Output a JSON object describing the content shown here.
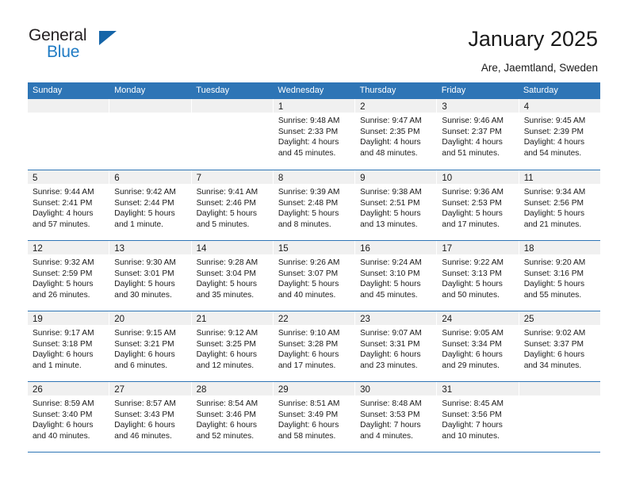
{
  "brand": {
    "name_part1": "General",
    "name_part2": "Blue"
  },
  "header": {
    "title": "January 2025",
    "location": "Are, Jaemtland, Sweden"
  },
  "calendar": {
    "weekday_headers": [
      "Sunday",
      "Monday",
      "Tuesday",
      "Wednesday",
      "Thursday",
      "Friday",
      "Saturday"
    ],
    "accent_color": "#2e75b6",
    "daynum_band_color": "#f0f0f0",
    "weeks": [
      [
        {
          "day": "",
          "sunrise": "",
          "sunset": "",
          "daylight_line1": "",
          "daylight_line2": ""
        },
        {
          "day": "",
          "sunrise": "",
          "sunset": "",
          "daylight_line1": "",
          "daylight_line2": ""
        },
        {
          "day": "",
          "sunrise": "",
          "sunset": "",
          "daylight_line1": "",
          "daylight_line2": ""
        },
        {
          "day": "1",
          "sunrise": "Sunrise: 9:48 AM",
          "sunset": "Sunset: 2:33 PM",
          "daylight_line1": "Daylight: 4 hours",
          "daylight_line2": "and 45 minutes."
        },
        {
          "day": "2",
          "sunrise": "Sunrise: 9:47 AM",
          "sunset": "Sunset: 2:35 PM",
          "daylight_line1": "Daylight: 4 hours",
          "daylight_line2": "and 48 minutes."
        },
        {
          "day": "3",
          "sunrise": "Sunrise: 9:46 AM",
          "sunset": "Sunset: 2:37 PM",
          "daylight_line1": "Daylight: 4 hours",
          "daylight_line2": "and 51 minutes."
        },
        {
          "day": "4",
          "sunrise": "Sunrise: 9:45 AM",
          "sunset": "Sunset: 2:39 PM",
          "daylight_line1": "Daylight: 4 hours",
          "daylight_line2": "and 54 minutes."
        }
      ],
      [
        {
          "day": "5",
          "sunrise": "Sunrise: 9:44 AM",
          "sunset": "Sunset: 2:41 PM",
          "daylight_line1": "Daylight: 4 hours",
          "daylight_line2": "and 57 minutes."
        },
        {
          "day": "6",
          "sunrise": "Sunrise: 9:42 AM",
          "sunset": "Sunset: 2:44 PM",
          "daylight_line1": "Daylight: 5 hours",
          "daylight_line2": "and 1 minute."
        },
        {
          "day": "7",
          "sunrise": "Sunrise: 9:41 AM",
          "sunset": "Sunset: 2:46 PM",
          "daylight_line1": "Daylight: 5 hours",
          "daylight_line2": "and 5 minutes."
        },
        {
          "day": "8",
          "sunrise": "Sunrise: 9:39 AM",
          "sunset": "Sunset: 2:48 PM",
          "daylight_line1": "Daylight: 5 hours",
          "daylight_line2": "and 8 minutes."
        },
        {
          "day": "9",
          "sunrise": "Sunrise: 9:38 AM",
          "sunset": "Sunset: 2:51 PM",
          "daylight_line1": "Daylight: 5 hours",
          "daylight_line2": "and 13 minutes."
        },
        {
          "day": "10",
          "sunrise": "Sunrise: 9:36 AM",
          "sunset": "Sunset: 2:53 PM",
          "daylight_line1": "Daylight: 5 hours",
          "daylight_line2": "and 17 minutes."
        },
        {
          "day": "11",
          "sunrise": "Sunrise: 9:34 AM",
          "sunset": "Sunset: 2:56 PM",
          "daylight_line1": "Daylight: 5 hours",
          "daylight_line2": "and 21 minutes."
        }
      ],
      [
        {
          "day": "12",
          "sunrise": "Sunrise: 9:32 AM",
          "sunset": "Sunset: 2:59 PM",
          "daylight_line1": "Daylight: 5 hours",
          "daylight_line2": "and 26 minutes."
        },
        {
          "day": "13",
          "sunrise": "Sunrise: 9:30 AM",
          "sunset": "Sunset: 3:01 PM",
          "daylight_line1": "Daylight: 5 hours",
          "daylight_line2": "and 30 minutes."
        },
        {
          "day": "14",
          "sunrise": "Sunrise: 9:28 AM",
          "sunset": "Sunset: 3:04 PM",
          "daylight_line1": "Daylight: 5 hours",
          "daylight_line2": "and 35 minutes."
        },
        {
          "day": "15",
          "sunrise": "Sunrise: 9:26 AM",
          "sunset": "Sunset: 3:07 PM",
          "daylight_line1": "Daylight: 5 hours",
          "daylight_line2": "and 40 minutes."
        },
        {
          "day": "16",
          "sunrise": "Sunrise: 9:24 AM",
          "sunset": "Sunset: 3:10 PM",
          "daylight_line1": "Daylight: 5 hours",
          "daylight_line2": "and 45 minutes."
        },
        {
          "day": "17",
          "sunrise": "Sunrise: 9:22 AM",
          "sunset": "Sunset: 3:13 PM",
          "daylight_line1": "Daylight: 5 hours",
          "daylight_line2": "and 50 minutes."
        },
        {
          "day": "18",
          "sunrise": "Sunrise: 9:20 AM",
          "sunset": "Sunset: 3:16 PM",
          "daylight_line1": "Daylight: 5 hours",
          "daylight_line2": "and 55 minutes."
        }
      ],
      [
        {
          "day": "19",
          "sunrise": "Sunrise: 9:17 AM",
          "sunset": "Sunset: 3:18 PM",
          "daylight_line1": "Daylight: 6 hours",
          "daylight_line2": "and 1 minute."
        },
        {
          "day": "20",
          "sunrise": "Sunrise: 9:15 AM",
          "sunset": "Sunset: 3:21 PM",
          "daylight_line1": "Daylight: 6 hours",
          "daylight_line2": "and 6 minutes."
        },
        {
          "day": "21",
          "sunrise": "Sunrise: 9:12 AM",
          "sunset": "Sunset: 3:25 PM",
          "daylight_line1": "Daylight: 6 hours",
          "daylight_line2": "and 12 minutes."
        },
        {
          "day": "22",
          "sunrise": "Sunrise: 9:10 AM",
          "sunset": "Sunset: 3:28 PM",
          "daylight_line1": "Daylight: 6 hours",
          "daylight_line2": "and 17 minutes."
        },
        {
          "day": "23",
          "sunrise": "Sunrise: 9:07 AM",
          "sunset": "Sunset: 3:31 PM",
          "daylight_line1": "Daylight: 6 hours",
          "daylight_line2": "and 23 minutes."
        },
        {
          "day": "24",
          "sunrise": "Sunrise: 9:05 AM",
          "sunset": "Sunset: 3:34 PM",
          "daylight_line1": "Daylight: 6 hours",
          "daylight_line2": "and 29 minutes."
        },
        {
          "day": "25",
          "sunrise": "Sunrise: 9:02 AM",
          "sunset": "Sunset: 3:37 PM",
          "daylight_line1": "Daylight: 6 hours",
          "daylight_line2": "and 34 minutes."
        }
      ],
      [
        {
          "day": "26",
          "sunrise": "Sunrise: 8:59 AM",
          "sunset": "Sunset: 3:40 PM",
          "daylight_line1": "Daylight: 6 hours",
          "daylight_line2": "and 40 minutes."
        },
        {
          "day": "27",
          "sunrise": "Sunrise: 8:57 AM",
          "sunset": "Sunset: 3:43 PM",
          "daylight_line1": "Daylight: 6 hours",
          "daylight_line2": "and 46 minutes."
        },
        {
          "day": "28",
          "sunrise": "Sunrise: 8:54 AM",
          "sunset": "Sunset: 3:46 PM",
          "daylight_line1": "Daylight: 6 hours",
          "daylight_line2": "and 52 minutes."
        },
        {
          "day": "29",
          "sunrise": "Sunrise: 8:51 AM",
          "sunset": "Sunset: 3:49 PM",
          "daylight_line1": "Daylight: 6 hours",
          "daylight_line2": "and 58 minutes."
        },
        {
          "day": "30",
          "sunrise": "Sunrise: 8:48 AM",
          "sunset": "Sunset: 3:53 PM",
          "daylight_line1": "Daylight: 7 hours",
          "daylight_line2": "and 4 minutes."
        },
        {
          "day": "31",
          "sunrise": "Sunrise: 8:45 AM",
          "sunset": "Sunset: 3:56 PM",
          "daylight_line1": "Daylight: 7 hours",
          "daylight_line2": "and 10 minutes."
        },
        {
          "day": "",
          "sunrise": "",
          "sunset": "",
          "daylight_line1": "",
          "daylight_line2": ""
        }
      ]
    ]
  }
}
